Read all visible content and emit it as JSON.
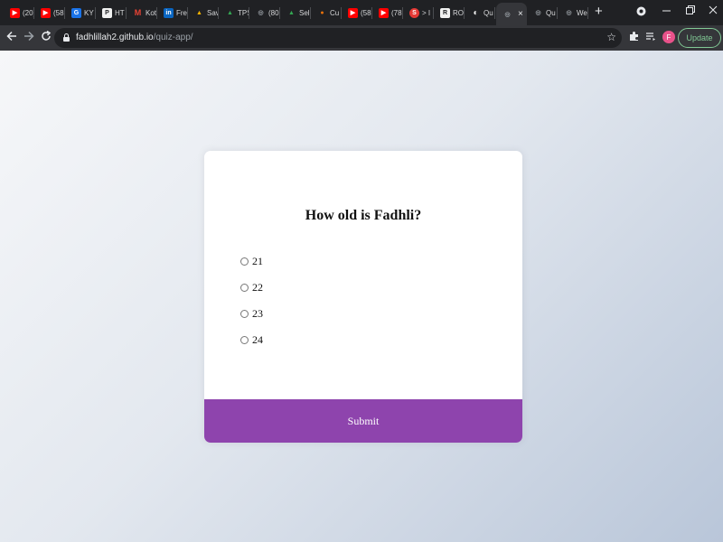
{
  "browser": {
    "tabs": [
      {
        "title": "(20)",
        "icon": "youtube-icon",
        "color": "#ff0000",
        "glyph": "▶"
      },
      {
        "title": "(58",
        "icon": "youtube-icon",
        "color": "#ff0000",
        "glyph": "▶"
      },
      {
        "title": "KY",
        "icon": "bookmark-site-icon",
        "color": "#1a73e8",
        "glyph": "G"
      },
      {
        "title": "HT",
        "icon": "p-site-icon",
        "color": "#f1f1f1",
        "glyph": "P"
      },
      {
        "title": "Kot",
        "icon": "gmail-icon",
        "color": "#ea4335",
        "glyph": "M"
      },
      {
        "title": "Fre",
        "icon": "linkedin-icon",
        "color": "#0a66c2",
        "glyph": "in"
      },
      {
        "title": "Sav",
        "icon": "triangle-site-icon",
        "color": "#f4b400",
        "glyph": "▲"
      },
      {
        "title": "TPS",
        "icon": "drive-icon",
        "color": "#34a853",
        "glyph": "▲"
      },
      {
        "title": "(80",
        "icon": "globe-icon",
        "color": "#9aa0a6",
        "glyph": "◎"
      },
      {
        "title": "Sel",
        "icon": "drive-icon",
        "color": "#34a853",
        "glyph": "▲"
      },
      {
        "title": "Cu",
        "icon": "orange-site-icon",
        "color": "#e8710a",
        "glyph": "●"
      },
      {
        "title": "(58",
        "icon": "youtube-icon",
        "color": "#ff0000",
        "glyph": "▶"
      },
      {
        "title": "(78",
        "icon": "youtube-icon",
        "color": "#ff0000",
        "glyph": "▶"
      },
      {
        "title": "> I",
        "icon": "red-circle-site-icon",
        "color": "#e53935",
        "glyph": "S"
      },
      {
        "title": "RO",
        "icon": "square-site-icon",
        "color": "#f1f1f1",
        "glyph": "R"
      },
      {
        "title": "Qu",
        "icon": "github-icon",
        "color": "#f1f1f1",
        "glyph": "◐"
      },
      {
        "title": "",
        "icon": "globe-icon",
        "color": "#9aa0a6",
        "glyph": "◎",
        "active": true
      },
      {
        "title": "Qu",
        "icon": "globe-icon",
        "color": "#9aa0a6",
        "glyph": "◎"
      },
      {
        "title": "We",
        "icon": "globe-icon",
        "color": "#9aa0a6",
        "glyph": "◎"
      }
    ],
    "active_tab_close": "×",
    "new_tab": "+",
    "url_host": "fadhlillah2.github.io",
    "url_path": "/quiz-app/",
    "profile_initial": "F",
    "update_label": "Update",
    "accent_color": "#8e44ad"
  },
  "quiz": {
    "question": "How old is Fadhli?",
    "answers": [
      "21",
      "22",
      "23",
      "24"
    ],
    "submit_label": "Submit"
  }
}
